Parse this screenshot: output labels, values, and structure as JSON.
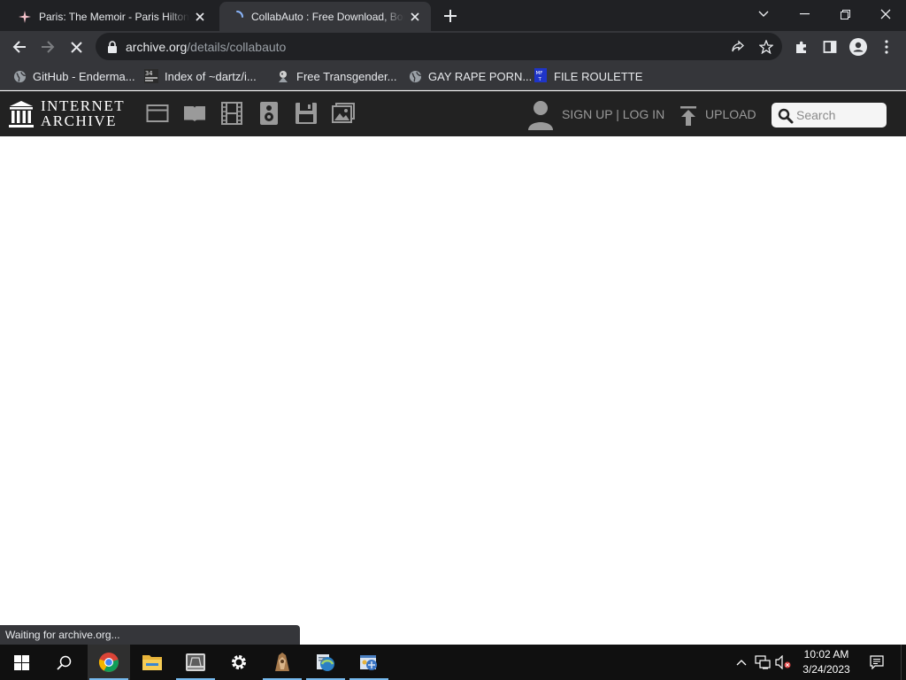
{
  "browser": {
    "tabs": [
      {
        "title": "Paris: The Memoir - Paris Hilton",
        "active": false
      },
      {
        "title": "CollabAuto : Free Download, Borrow, and Streaming",
        "active": true
      }
    ],
    "url_host": "archive.org",
    "url_path": "/details/collabauto",
    "status_text": "Waiting for archive.org...",
    "loading": true
  },
  "bookmarks": [
    {
      "label": "GitHub - Enderma...",
      "icon": "globe-icon"
    },
    {
      "label": "Index of ~dartz/i...",
      "icon": "index-favicon"
    },
    {
      "label": "Free Transgender...",
      "icon": "site-favicon"
    },
    {
      "label": "GAY RAPE PORN...",
      "icon": "globe-icon"
    },
    {
      "label": "FILE ROULETTE",
      "icon": "mft-favicon"
    }
  ],
  "archive_nav": {
    "logo_line1": "INTERNET",
    "logo_line2": "ARCHIVE",
    "media_icons": [
      "web-icon",
      "texts-icon",
      "video-icon",
      "audio-icon",
      "software-icon",
      "images-icon"
    ],
    "signup_login": "SIGN UP | LOG IN",
    "upload": "UPLOAD",
    "search_placeholder": "Search"
  },
  "taskbar": {
    "time": "10:02 AM",
    "date": "3/24/2023",
    "apps": [
      "chrome-icon",
      "file-explorer-icon",
      "drive-icon",
      "settings-icon",
      "app-icon",
      "ie-icon",
      "control-panel-icon"
    ]
  },
  "colors": {
    "tabstrip": "#202124",
    "toolbar": "#35363a",
    "archive_nav": "#222222",
    "taskbar": "#101010"
  }
}
